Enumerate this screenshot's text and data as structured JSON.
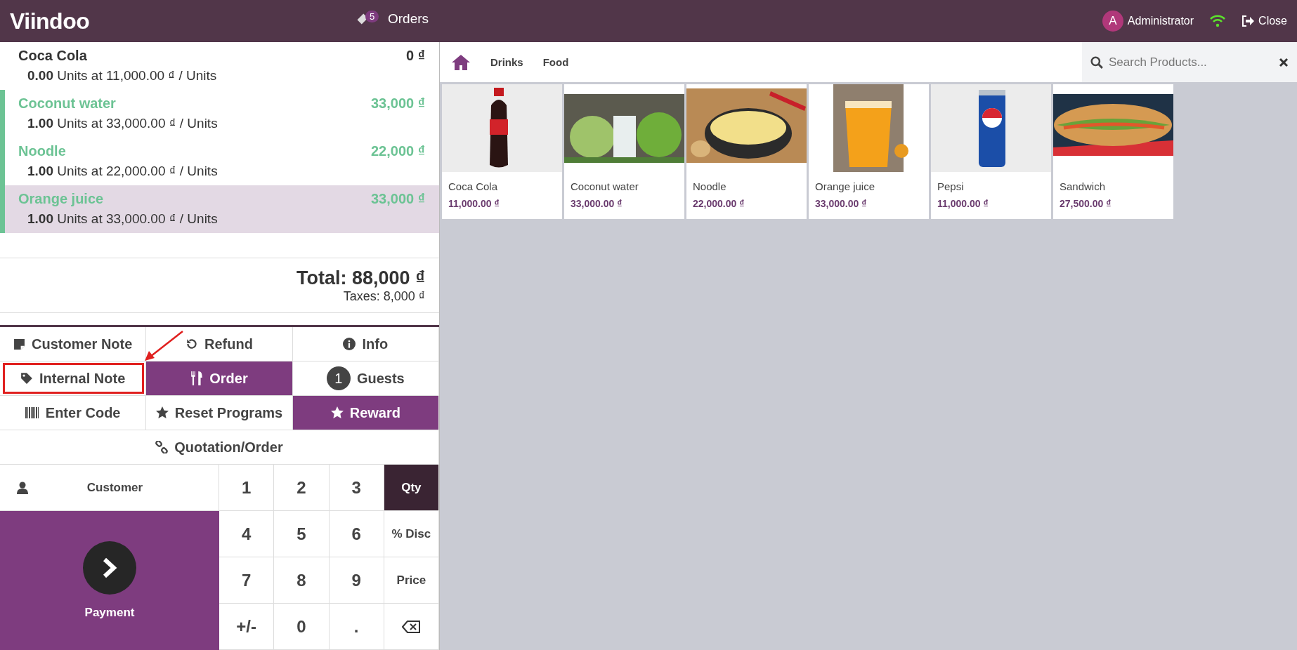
{
  "header": {
    "logo": "Viindoo",
    "orders_count": "5",
    "orders_label": "Orders",
    "user_initial": "A",
    "user_name": "Administrator",
    "close_label": "Close"
  },
  "order_lines": [
    {
      "name": "Coca Cola",
      "price": "0 ₫",
      "detail": "**0.00** Units at 11,000.00 ₫ / Units",
      "pending": false,
      "selected": false
    },
    {
      "name": "Coconut water",
      "price": "33,000 ₫",
      "detail": "**1.00** Units at 33,000.00 ₫ / Units",
      "pending": true,
      "selected": false
    },
    {
      "name": "Noodle",
      "price": "22,000 ₫",
      "detail": "**1.00** Units at 22,000.00 ₫ / Units",
      "pending": true,
      "selected": false
    },
    {
      "name": "Orange juice",
      "price": "33,000 ₫",
      "detail": "**1.00** Units at 33,000.00 ₫ / Units",
      "pending": true,
      "selected": true
    }
  ],
  "summary": {
    "total": "Total: 88,000 ₫",
    "taxes": "Taxes: 8,000 ₫"
  },
  "control_buttons": [
    {
      "kind": "note",
      "label": "Customer Note",
      "active": false,
      "highlighted": false
    },
    {
      "kind": "refund",
      "label": "Refund",
      "active": false,
      "highlighted": false
    },
    {
      "kind": "info",
      "label": "Info",
      "active": false,
      "highlighted": false
    },
    {
      "kind": "tag",
      "label": "Internal Note",
      "active": false,
      "highlighted": true
    },
    {
      "kind": "order",
      "label": "Order",
      "active": true,
      "highlighted": false
    },
    {
      "kind": "guests",
      "label": "Guests",
      "badge": "1",
      "active": false,
      "highlighted": false
    },
    {
      "kind": "code",
      "label": "Enter Code",
      "active": false,
      "highlighted": false
    },
    {
      "kind": "star",
      "label": "Reset Programs",
      "active": false,
      "highlighted": false
    },
    {
      "kind": "star",
      "label": "Reward",
      "active": true,
      "highlighted": false
    },
    {
      "kind": "link",
      "label": "Quotation/Order",
      "active": false,
      "highlighted": false
    }
  ],
  "customer_button": {
    "label": "Customer"
  },
  "payment_button": {
    "label": "Payment"
  },
  "numpad": [
    {
      "kind": "digit",
      "label": "1"
    },
    {
      "kind": "digit",
      "label": "2"
    },
    {
      "kind": "digit",
      "label": "3"
    },
    {
      "kind": "mode",
      "label": "Qty",
      "selected": true
    },
    {
      "kind": "digit",
      "label": "4"
    },
    {
      "kind": "digit",
      "label": "5"
    },
    {
      "kind": "digit",
      "label": "6"
    },
    {
      "kind": "mode",
      "label": "% Disc",
      "selected": false
    },
    {
      "kind": "digit",
      "label": "7"
    },
    {
      "kind": "digit",
      "label": "8"
    },
    {
      "kind": "digit",
      "label": "9"
    },
    {
      "kind": "mode",
      "label": "Price",
      "selected": false
    },
    {
      "kind": "digit",
      "label": "+/-"
    },
    {
      "kind": "digit",
      "label": "0"
    },
    {
      "kind": "digit",
      "label": "."
    },
    {
      "kind": "backspace"
    }
  ],
  "categories": [
    {
      "label": "Drinks"
    },
    {
      "label": "Food"
    }
  ],
  "search": {
    "placeholder": "Search Products..."
  },
  "products": [
    {
      "name": "Coca Cola",
      "price": "11,000.00 ₫",
      "kind": "picture"
    },
    {
      "name": "Coconut water",
      "price": "33,000.00 ₫",
      "kind": "picture"
    },
    {
      "name": "Noodle",
      "price": "22,000.00 ₫",
      "kind": "picture"
    },
    {
      "name": "Orange juice",
      "price": "33,000.00 ₫",
      "kind": "picture"
    },
    {
      "name": "Pepsi",
      "price": "11,000.00 ₫",
      "kind": "picture"
    },
    {
      "name": "Sandwich",
      "price": "27,500.00 ₫",
      "kind": "picture"
    }
  ]
}
